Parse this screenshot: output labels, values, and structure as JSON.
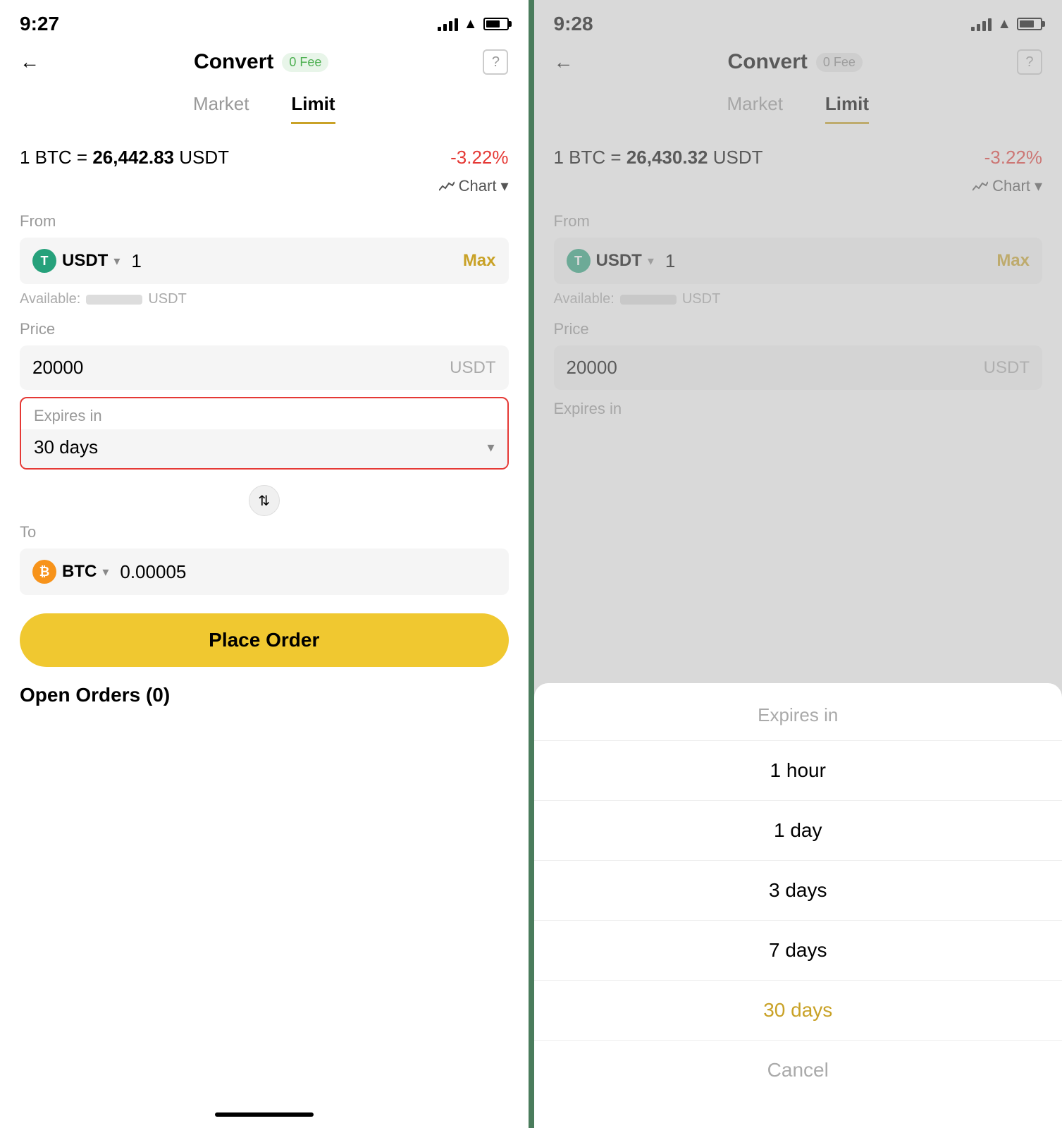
{
  "left": {
    "time": "9:27",
    "header": {
      "title": "Convert",
      "fee_badge": "0 Fee",
      "back_label": "←",
      "help_label": "?"
    },
    "tabs": {
      "market": "Market",
      "limit": "Limit"
    },
    "rate": {
      "prefix": "1 BTC =",
      "value": "26,442.83",
      "unit": "USDT",
      "change": "-3.22%"
    },
    "chart_label": "Chart",
    "from": {
      "label": "From",
      "currency": "USDT",
      "value": "1",
      "max_label": "Max",
      "available_label": "Available:",
      "available_unit": "USDT"
    },
    "price": {
      "label": "Price",
      "value": "20000",
      "unit": "USDT"
    },
    "expires": {
      "label": "Expires in",
      "value": "30 days"
    },
    "to": {
      "label": "To",
      "currency": "BTC",
      "value": "0.00005"
    },
    "place_order": "Place Order",
    "open_orders": "Open Orders (0)"
  },
  "right": {
    "time": "9:28",
    "header": {
      "title": "Convert",
      "fee_badge": "0 Fee",
      "back_label": "←",
      "help_label": "?"
    },
    "tabs": {
      "market": "Market",
      "limit": "Limit"
    },
    "rate": {
      "prefix": "1 BTC =",
      "value": "26,430.32",
      "unit": "USDT",
      "change": "-3.22%"
    },
    "chart_label": "Chart",
    "from": {
      "label": "From",
      "currency": "USDT",
      "value": "1",
      "max_label": "Max",
      "available_label": "Available:",
      "available_unit": "USDT"
    },
    "price": {
      "label": "Price",
      "value": "20000",
      "unit": "USDT"
    },
    "expires_label": "Expires in",
    "sheet": {
      "title": "Expires in",
      "options": [
        "1 hour",
        "1 day",
        "3 days",
        "7 days",
        "30 days",
        "Cancel"
      ],
      "selected": "30 days",
      "cancel": "Cancel"
    }
  }
}
